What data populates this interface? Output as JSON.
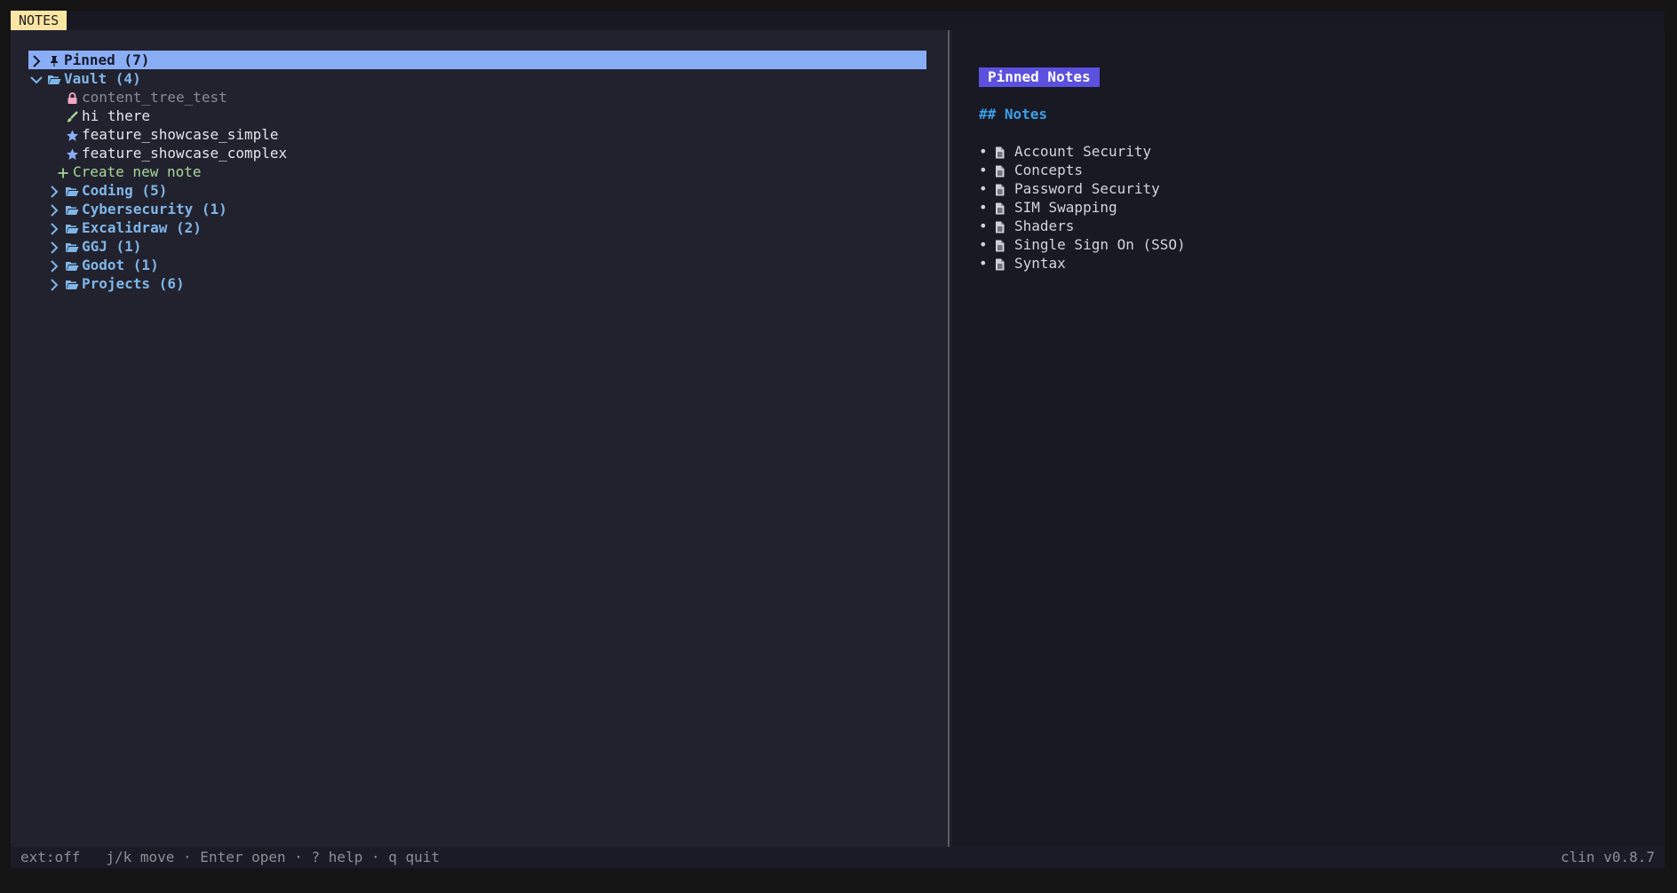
{
  "app": {
    "title": "NOTES",
    "version": "clin v0.8.7"
  },
  "tree": {
    "pinned": {
      "label": "Pinned (7)",
      "expanded": false
    },
    "vault": {
      "label": "Vault (4)",
      "expanded": true,
      "notes": [
        {
          "label": "content_tree_test",
          "icon": "lock-icon"
        },
        {
          "label": "hi there",
          "icon": "brush-icon"
        },
        {
          "label": "feature_showcase_simple",
          "icon": "star-icon"
        },
        {
          "label": "feature_showcase_complex",
          "icon": "star-icon"
        }
      ],
      "create_label": "Create new note"
    },
    "folders": [
      {
        "label": "Coding (5)"
      },
      {
        "label": "Cybersecurity (1)"
      },
      {
        "label": "Excalidraw (2)"
      },
      {
        "label": "GGJ (1)"
      },
      {
        "label": "Godot (1)"
      },
      {
        "label": "Projects (6)"
      }
    ]
  },
  "preview": {
    "badge": "Pinned Notes",
    "heading": "## Notes",
    "items": [
      "Account Security",
      "Concepts",
      "Password Security",
      "SIM Swapping",
      "Shaders",
      "Single Sign On (SSO)",
      "Syntax"
    ]
  },
  "status": {
    "ext": "ext:off",
    "hints": "j/k move · Enter open · ? help · q quit"
  },
  "colors": {
    "selection": "#8aaef5",
    "folder": "#7fb6e8",
    "badge": "#5b51de",
    "heading": "#3aa0e8",
    "create": "#a6d89a",
    "title_badge": "#fce5a3"
  }
}
